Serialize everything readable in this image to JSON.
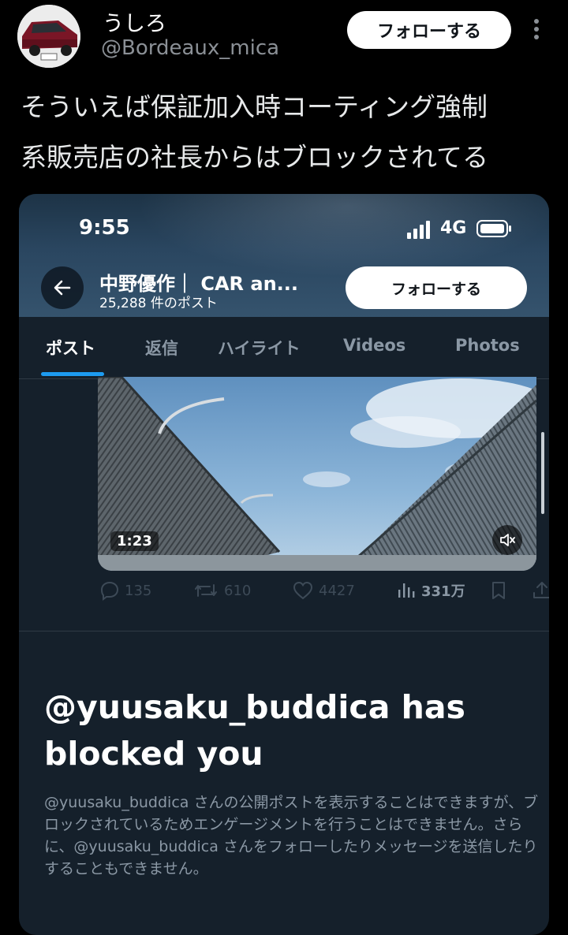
{
  "tweet": {
    "display_name": "うしろ",
    "handle": "@Bordeaux_mica",
    "follow_label": "フォローする",
    "text_lines": [
      "そういえば保証加入時コーティング強制",
      "系販売店の社長からはブロックされてる"
    ]
  },
  "embedded": {
    "status_bar": {
      "time": "9:55",
      "network": "4G"
    },
    "profile": {
      "name": "中野優作｜ CAR an...",
      "post_count": "25,288 件のポスト",
      "follow_label": "フォローする"
    },
    "tabs": [
      "ポスト",
      "返信",
      "ハイライト",
      "Videos",
      "Photos"
    ],
    "active_tab": "ポスト",
    "video": {
      "duration": "1:23"
    },
    "engagement": {
      "replies": "135",
      "reposts": "610",
      "likes": "4427",
      "views": "331万"
    },
    "blocked": {
      "title": "@yuusaku_buddica has blocked you",
      "description": "@yuusaku_buddica さんの公開ポストを表示することはできますが、ブロックされているためエンゲージメントを行うことはできません。さらに、@yuusaku_buddica さんをフォローしたりメッセージを送信したりすることもできません。"
    }
  },
  "colors": {
    "background": "#000000",
    "card_background": "#15202b",
    "accent": "#1d9bf0",
    "muted_text": "#8b98a5"
  }
}
